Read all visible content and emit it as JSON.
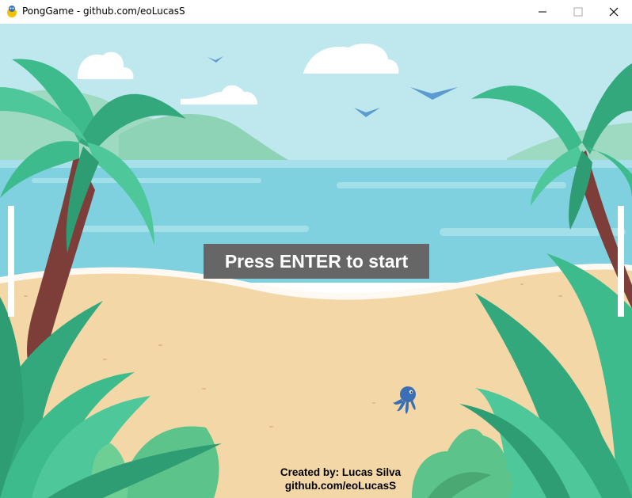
{
  "window": {
    "title": "PongGame - github.com/eoLucasS",
    "icon": "pygame-snake-icon"
  },
  "game": {
    "start_prompt": "Press ENTER to start",
    "credit_line1": "Created by: Lucas Silva",
    "credit_line2": "github.com/eoLucasS",
    "scene": "beach-background",
    "ball": "octopus-ball"
  },
  "colors": {
    "sky": "#bfe8ee",
    "sea": "#7fd1e0",
    "sand": "#f3d7a6",
    "palm_leaf": "#3dbb8c",
    "trunk": "#7d3e3a",
    "paddle": "#ffffff",
    "prompt_bg": "#666666"
  }
}
